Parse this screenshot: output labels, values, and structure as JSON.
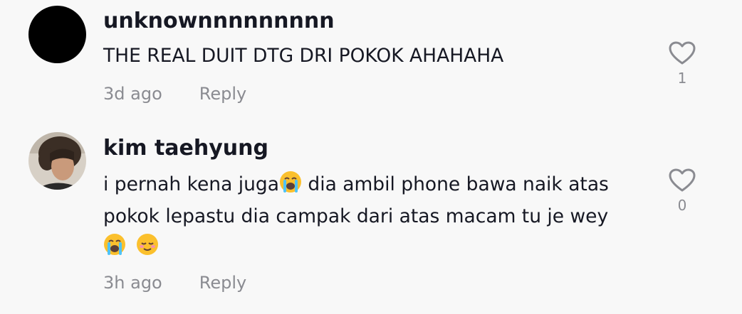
{
  "comments": [
    {
      "username": "unknownnnnnnnnn",
      "text": "THE REAL DUIT DTG DRI POKOK AHAHAHA",
      "time": "3d ago",
      "reply_label": "Reply",
      "likes": "1",
      "avatar": "black-circle"
    },
    {
      "username": "kim taehyung",
      "text_part1": "i pernah kena juga",
      "text_part2": " dia ambil phone bawa naik atas pokok lepastu dia campak dari atas macam tu je wey",
      "emoji_names": [
        "loudly-crying-face-emoji",
        "relieved-face-emoji"
      ],
      "time": "3h ago",
      "reply_label": "Reply",
      "likes": "0",
      "avatar": "profile-photo"
    }
  ],
  "colors": {
    "background": "#f8f8f8",
    "text": "#161823",
    "meta": "#8a8b91",
    "heart_outline": "#8a8b91",
    "emoji_yellow": "#fbc02d"
  },
  "icons": {
    "like": "heart-outline-icon"
  }
}
